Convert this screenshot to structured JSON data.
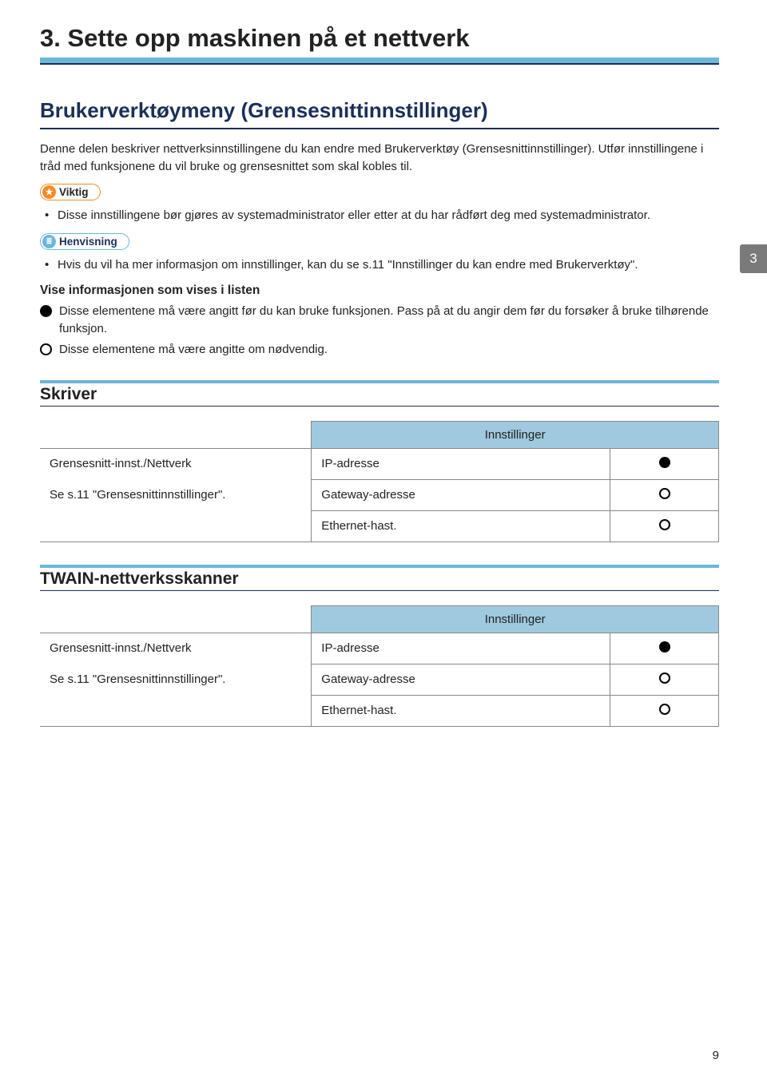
{
  "chapter": {
    "title": "3. Sette opp maskinen på et nettverk"
  },
  "section": {
    "title": "Brukerverktøymeny (Grensesnittinnstillinger)",
    "intro1": "Denne delen beskriver nettverksinnstillingene du kan endre med Brukerverktøy (Grensesnittinnstillinger). Utfør innstillingene i tråd med funksjonene du vil bruke og grensesnittet som skal kobles til."
  },
  "callouts": {
    "important": "Viktig",
    "reference": "Henvisning"
  },
  "important_bullet": "Disse innstillingene bør gjøres av systemadministrator eller etter at du har rådført deg med systemadministrator.",
  "reference_bullet": "Hvis du vil ha mer informasjon om innstillinger, kan du se s.11 \"Innstillinger du kan endre med Brukerverktøy\".",
  "list_info": {
    "heading": "Vise informasjonen som vises i listen",
    "filled": "Disse elementene må være angitt før du kan bruke funksjonen. Pass på at du angir dem før du forsøker å bruke tilhørende funksjon.",
    "open": "Disse elementene må være angitte om nødvendig."
  },
  "page_tab": "3",
  "table_header": "Innstillinger",
  "printer": {
    "title": "Skriver",
    "left1": "Grensesnitt-innst./Nettverk",
    "left2": "Se s.11 \"Grensesnittinnstillinger\".",
    "rows": [
      {
        "label": "IP-adresse",
        "mark": "filled"
      },
      {
        "label": "Gateway-adresse",
        "mark": "open"
      },
      {
        "label": "Ethernet-hast.",
        "mark": "open"
      }
    ]
  },
  "twain": {
    "title": "TWAIN-nettverksskanner",
    "left1": "Grensesnitt-innst./Nettverk",
    "left2": "Se s.11 \"Grensesnittinnstillinger\".",
    "rows": [
      {
        "label": "IP-adresse",
        "mark": "filled"
      },
      {
        "label": "Gateway-adresse",
        "mark": "open"
      },
      {
        "label": "Ethernet-hast.",
        "mark": "open"
      }
    ]
  },
  "page_number": "9"
}
